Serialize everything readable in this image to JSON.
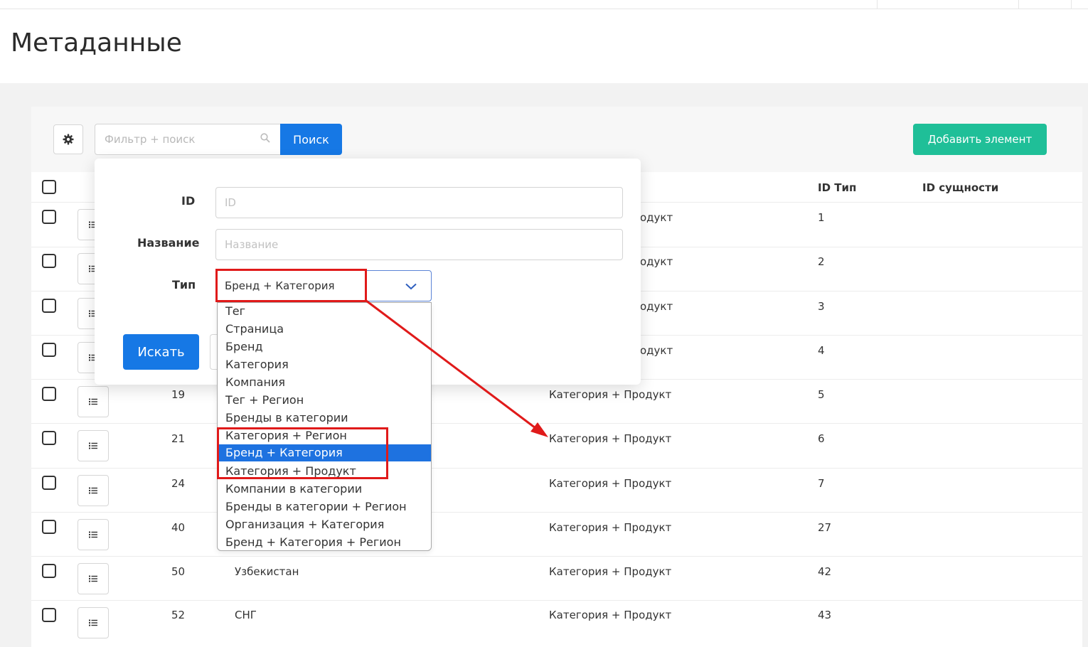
{
  "page": {
    "title": "Метаданные"
  },
  "toolbar": {
    "search_placeholder": "Фильтр + поиск",
    "search_button": "Поиск",
    "add_button": "Добавить элемент"
  },
  "table": {
    "headers": {
      "type_id": "ID Тип",
      "entity_id": "ID сущности"
    },
    "rows": [
      {
        "id": "",
        "name": "",
        "type": "одукт",
        "type_id": "1"
      },
      {
        "id": "",
        "name": "",
        "type": "одукт",
        "type_id": "2"
      },
      {
        "id": "",
        "name": "",
        "type": "одукт",
        "type_id": "3"
      },
      {
        "id": "",
        "name": "",
        "type": "одукт",
        "type_id": "4"
      },
      {
        "id": "19",
        "name": "",
        "type": "Категория + Продукт",
        "type_id": "5"
      },
      {
        "id": "21",
        "name": "",
        "type": "Категория + Продукт",
        "type_id": "6"
      },
      {
        "id": "24",
        "name": "",
        "type": "Категория + Продукт",
        "type_id": "7"
      },
      {
        "id": "40",
        "name": "",
        "type": "Категория + Продукт",
        "type_id": "27"
      },
      {
        "id": "50",
        "name": "Узбекистан",
        "type": "Категория + Продукт",
        "type_id": "42"
      },
      {
        "id": "52",
        "name": "СНГ",
        "type": "Категория + Продукт",
        "type_id": "43"
      }
    ]
  },
  "filter": {
    "id_label": "ID",
    "id_placeholder": "ID",
    "name_label": "Название",
    "name_placeholder": "Название",
    "type_label": "Тип",
    "type_value": "Бренд + Категория",
    "submit": "Искать"
  },
  "dropdown": {
    "options": [
      "Тег",
      "Страница",
      "Бренд",
      "Категория",
      "Компания",
      "Тег + Регион",
      "Бренды в категории",
      "Категория + Регион",
      "Бренд + Категория",
      "Категория + Продукт",
      "Компании в категории",
      "Бренды в категории + Регион",
      "Организация + Категория",
      "Бренд + Категория + Регион"
    ],
    "selected_index": 8
  },
  "colors": {
    "primary": "#1678e5",
    "add": "#1fbf98",
    "selected": "#1e72e0",
    "annotation": "#e01a1a"
  }
}
